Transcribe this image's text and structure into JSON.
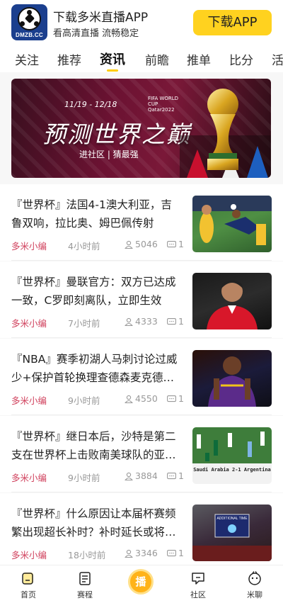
{
  "download_bar": {
    "logo_text": "DMZB.CC",
    "title": "下载多米直播APP",
    "subtitle": "看高清直播 流畅稳定",
    "button_label": "下载APP",
    "button_color": "#ffd21f"
  },
  "tabs": [
    {
      "label": "关注"
    },
    {
      "label": "推荐"
    },
    {
      "label": "资讯",
      "active": true
    },
    {
      "label": "前瞻"
    },
    {
      "label": "推单"
    },
    {
      "label": "比分"
    },
    {
      "label": "活"
    }
  ],
  "hero": {
    "dates": "11/19 - 12/18",
    "event_logo_text": "FIFA WORLD CUP Qatar2022",
    "headline": "预测世界之巅",
    "tag": "进社区 | 猜最强"
  },
  "news": [
    {
      "title": "『世界杯』法国4-1澳大利亚，吉鲁双响，拉比奥、姆巴佩传射",
      "author": "多米小编",
      "time": "4小时前",
      "views": "5046",
      "comments": "1"
    },
    {
      "title": "『世界杯』曼联官方：双方已达成一致，C罗即刻离队，立即生效",
      "author": "多米小编",
      "time": "7小时前",
      "views": "4333",
      "comments": "1"
    },
    {
      "title": "『NBA』赛季初湖人马刺讨论过威少+保护首轮换理查德森麦克德…",
      "author": "多米小编",
      "time": "9小时前",
      "views": "4550",
      "comments": "1"
    },
    {
      "title": "『世界杯』继日本后，沙特是第二支在世界杯上击败南美球队的亚…",
      "author": "多米小编",
      "time": "9小时前",
      "views": "3884",
      "comments": "1",
      "thumb_caption": "Saudi Arabia 2-1 Argentina"
    },
    {
      "title": "『世界杯』什么原因让本届杯赛频繁出现超长补时？补时延长或将…",
      "author": "多米小编",
      "time": "18小时前",
      "views": "3346",
      "comments": "1",
      "thumb_caption": "ADDITIONAL TIME"
    }
  ],
  "bottom_nav": [
    {
      "label": "首页",
      "icon": "home-icon"
    },
    {
      "label": "赛程",
      "icon": "schedule-icon"
    },
    {
      "label": "播",
      "icon": "live-icon"
    },
    {
      "label": "社区",
      "icon": "community-icon"
    },
    {
      "label": "米聊",
      "icon": "chat-icon"
    }
  ],
  "colors": {
    "accent": "#ffcc00",
    "author": "#d0405c",
    "meta": "#999999"
  }
}
